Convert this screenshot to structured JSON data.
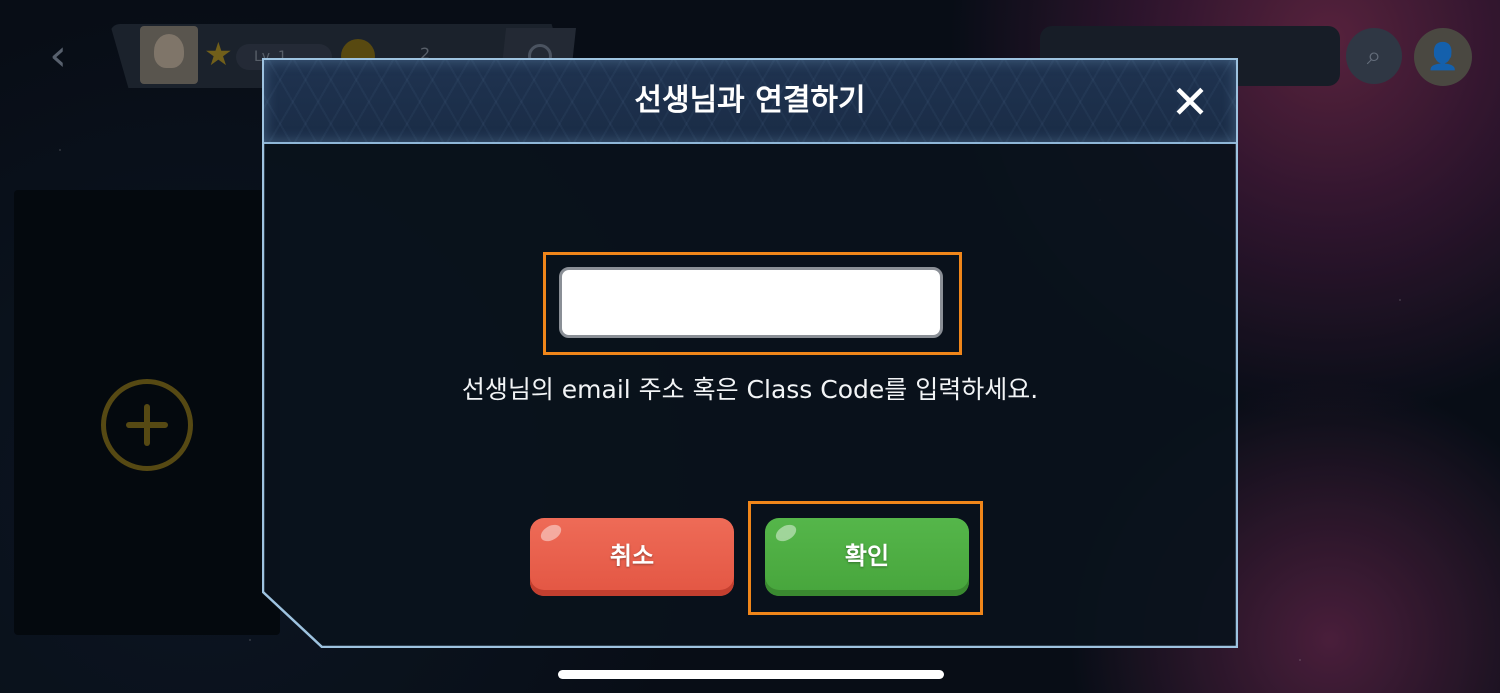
{
  "background": {
    "back_icon": "chevron-left-icon",
    "level_label": "Lv. 1",
    "coin_count": "2",
    "search_icon": "search-icon",
    "user_icon": "user-check-icon",
    "add_icon": "plus-circle-icon"
  },
  "modal": {
    "title": "선생님과 연결하기",
    "close_label": "✕",
    "input": {
      "value": "",
      "placeholder": ""
    },
    "instruction": "선생님의 email 주소 혹은 Class Code를 입력하세요.",
    "cancel_label": "취소",
    "confirm_label": "확인"
  },
  "colors": {
    "highlight": "#f0861a",
    "cancel": "#e35643",
    "confirm": "#47a53c",
    "header_border": "#8fb7d8"
  }
}
